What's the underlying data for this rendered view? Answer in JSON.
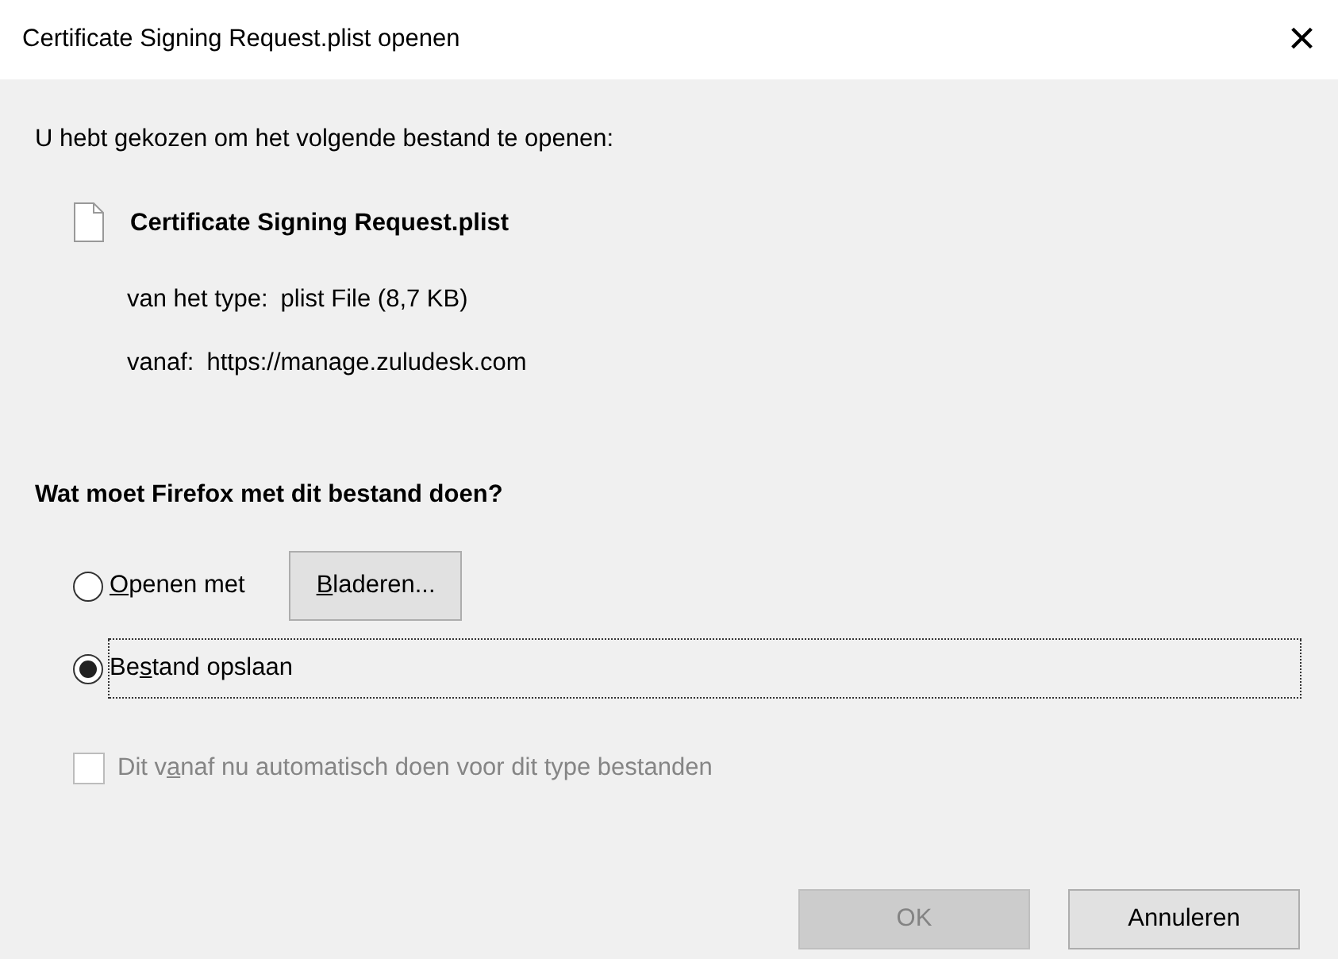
{
  "window": {
    "title": "Certificate Signing Request.plist openen",
    "close": "×"
  },
  "intro": "U hebt gekozen om het volgende bestand te openen:",
  "file": {
    "name": "Certificate Signing Request.plist",
    "details": [
      {
        "label": "van het type:",
        "value": "plist File (8,7 KB)"
      },
      {
        "label": "vanaf:",
        "value": "https://manage.zuludesk.com"
      }
    ]
  },
  "question": "Wat moet Firefox met dit bestand doen?",
  "options": [
    {
      "label_parts": [
        {
          "text": "O",
          "underlined": true
        },
        {
          "text": "penen met",
          "underlined": false
        }
      ],
      "selected": false,
      "focused": false,
      "browse_button": [
        {
          "text": "B",
          "underlined": true
        },
        {
          "text": "laderen...",
          "underlined": false
        }
      ]
    },
    {
      "label_parts": [
        {
          "text": "Be",
          "underlined": false
        },
        {
          "text": "s",
          "underlined": true
        },
        {
          "text": "tand opslaan",
          "underlined": false
        }
      ],
      "selected": true,
      "focused": true
    }
  ],
  "remember": {
    "label_parts": [
      {
        "text": "Dit v",
        "underlined": false
      },
      {
        "text": "a",
        "underlined": true
      },
      {
        "text": "naf nu automatisch doen voor dit type bestanden",
        "underlined": false
      }
    ],
    "checked": false,
    "disabled": true
  },
  "buttons": [
    {
      "label": "OK",
      "disabled": true
    },
    {
      "label": "Annuleren",
      "disabled": false
    }
  ]
}
